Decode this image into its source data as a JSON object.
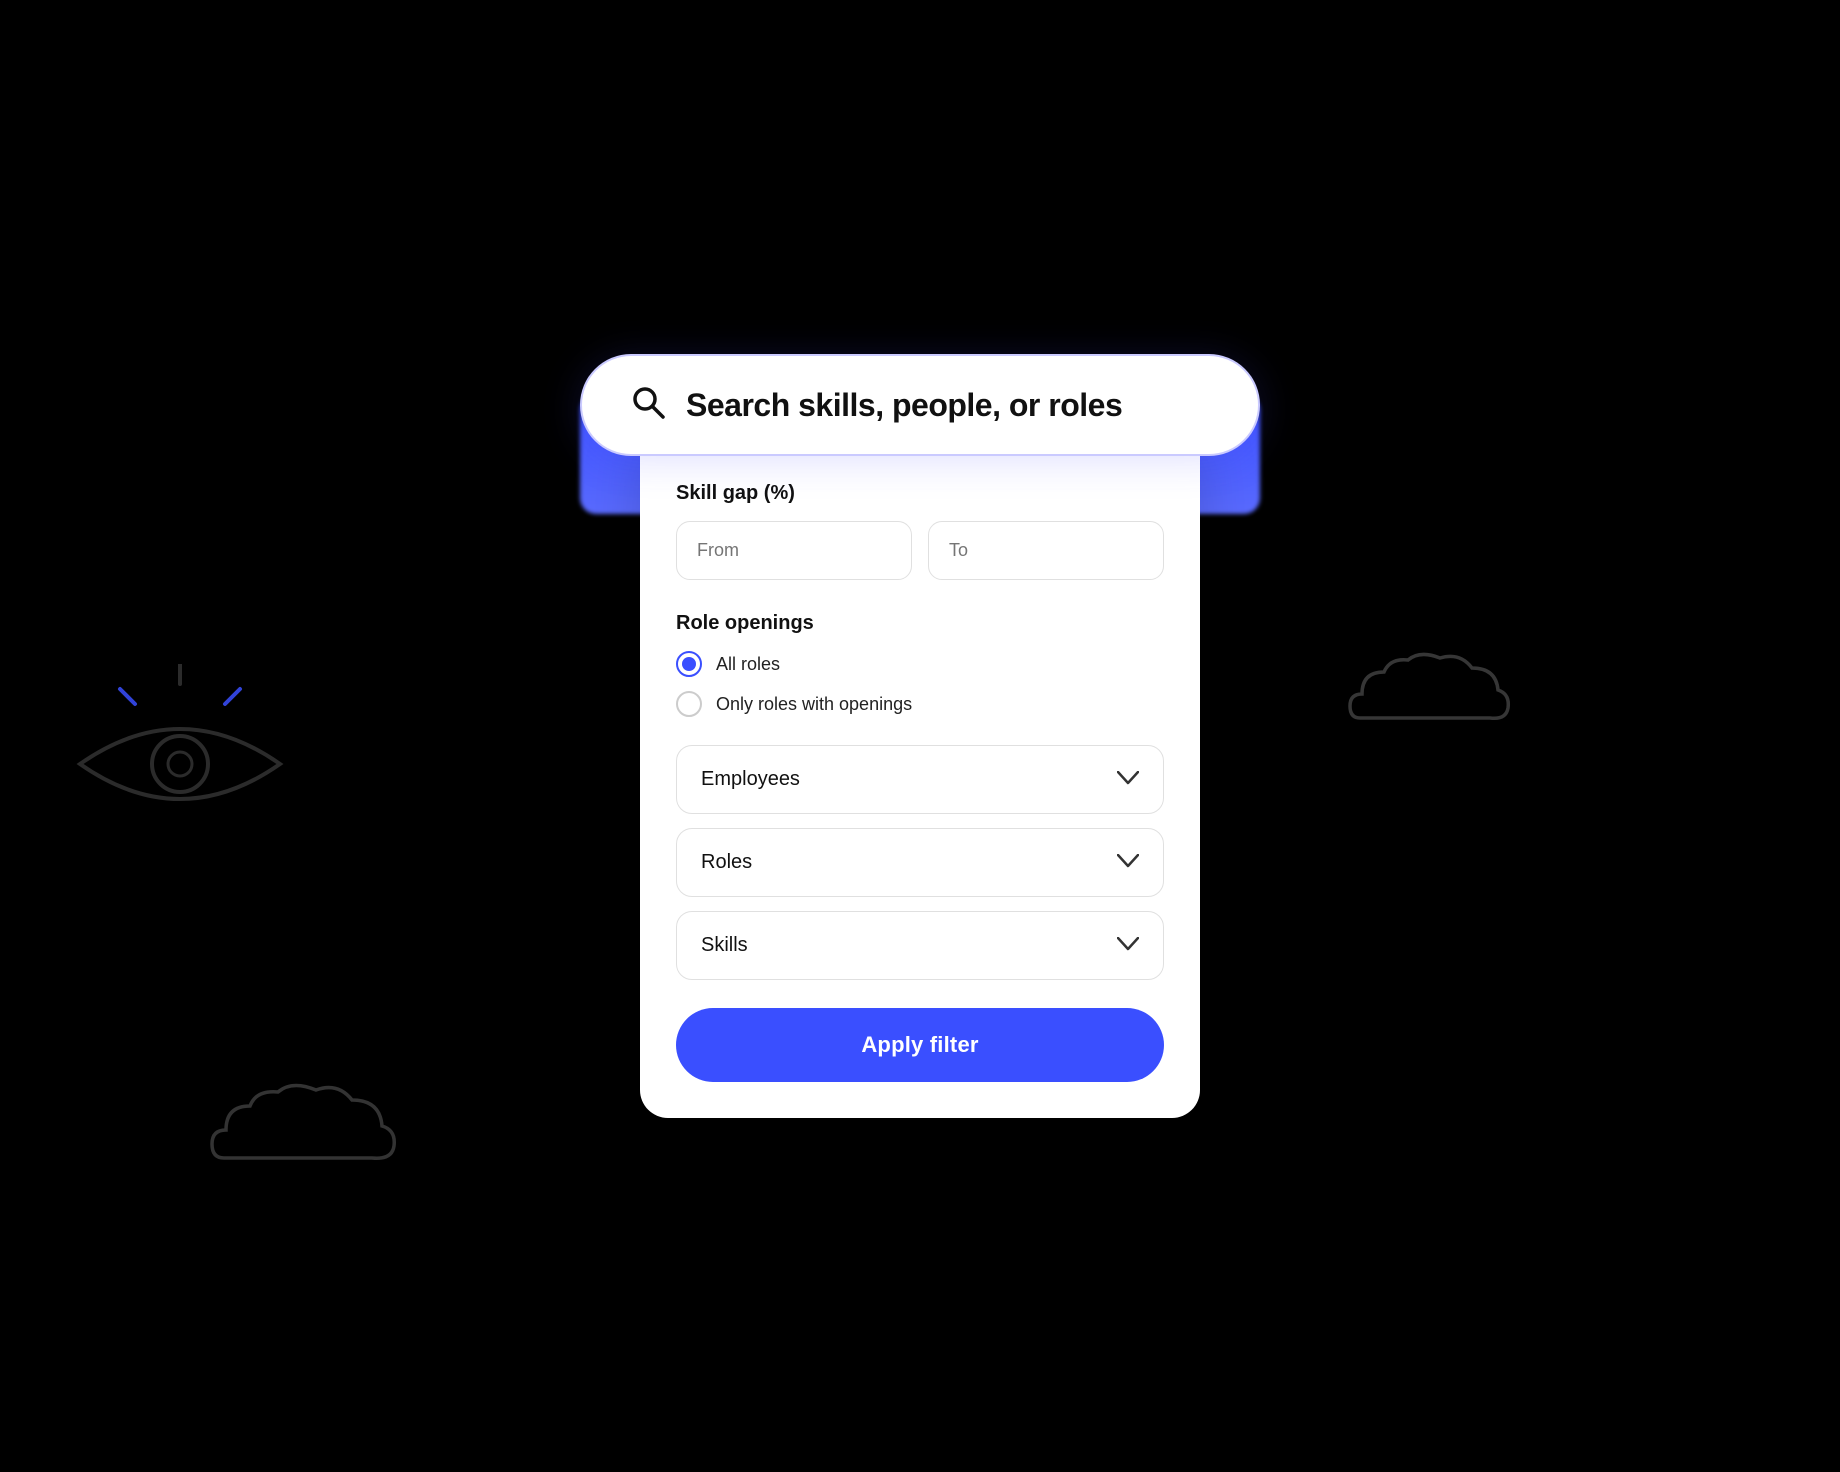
{
  "search": {
    "placeholder": "Search skills, people, or roles",
    "icon": "search-icon"
  },
  "filter_panel": {
    "skill_gap_label": "Skill gap (%)",
    "from_placeholder": "From",
    "to_placeholder": "To",
    "role_openings_label": "Role openings",
    "radio_options": [
      {
        "id": "all_roles",
        "label": "All roles",
        "selected": true
      },
      {
        "id": "only_openings",
        "label": "Only roles with openings",
        "selected": false
      }
    ],
    "dropdowns": [
      {
        "id": "employees",
        "label": "Employees"
      },
      {
        "id": "roles",
        "label": "Roles"
      },
      {
        "id": "skills",
        "label": "Skills"
      }
    ],
    "apply_button_label": "Apply filter"
  },
  "colors": {
    "accent": "#3a4fff",
    "border": "#e0e0e0",
    "text_primary": "#111",
    "text_muted": "#aaa"
  }
}
